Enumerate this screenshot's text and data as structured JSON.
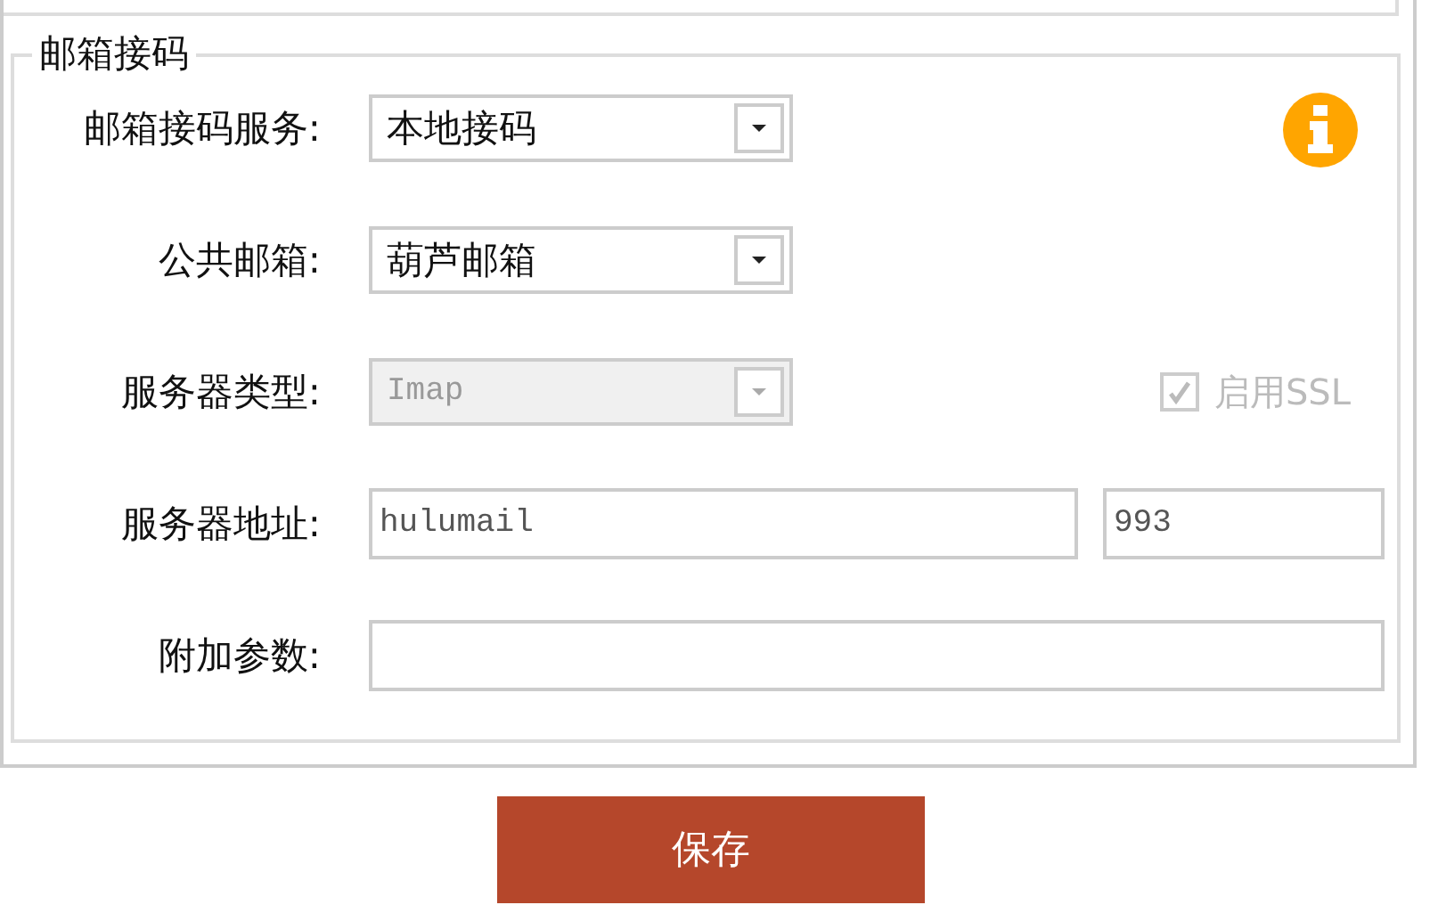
{
  "section": {
    "title": "邮箱接码"
  },
  "rows": [
    {
      "kind": "select",
      "label": "邮箱接码服务:",
      "value": "本地接码",
      "disabled": false,
      "info": true
    },
    {
      "kind": "select",
      "label": "公共邮箱:",
      "value": "葫芦邮箱",
      "disabled": false
    },
    {
      "kind": "select",
      "label": "服务器类型:",
      "value": "Imap",
      "disabled": true,
      "option": {
        "label": "启用SSL",
        "checked": true,
        "disabled": true
      }
    },
    {
      "kind": "address",
      "label": "服务器地址:",
      "value": "hulumail",
      "port": "993"
    },
    {
      "kind": "text",
      "label": "附加参数:"
    }
  ],
  "save_button": "保存"
}
